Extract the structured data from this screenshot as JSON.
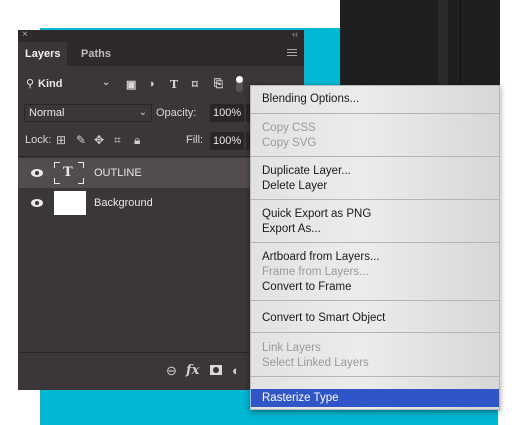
{
  "panel": {
    "tabs": [
      {
        "label": "Layers",
        "active": true
      },
      {
        "label": "Paths",
        "active": false
      }
    ],
    "close_glyph": "×",
    "collapse_glyph": "‹‹",
    "filter": {
      "kind_label": "Kind"
    },
    "blend_mode": "Normal",
    "opacity_label": "Opacity:",
    "opacity_value": "100%",
    "lock_label": "Lock:",
    "fill_label": "Fill:",
    "fill_value": "100%",
    "layers": [
      {
        "name": "OUTLINE",
        "type": "text",
        "thumb_glyph": "T",
        "selected": true,
        "visible": true
      },
      {
        "name": "Background",
        "type": "image",
        "selected": false,
        "visible": true
      }
    ],
    "icons": [
      "search-icon",
      "pixel-filter-icon",
      "adjustment-filter-icon",
      "type-filter-icon",
      "shape-filter-icon",
      "smart-object-filter-icon",
      "filter-toggle",
      "lock-transparent-icon",
      "lock-brush-icon",
      "lock-move-icon",
      "lock-artboard-icon",
      "lock-all-icon",
      "eye-icon",
      "link-icon",
      "fx-icon",
      "mask-icon",
      "adjustment-icon",
      "folder-icon",
      "new-layer-icon"
    ]
  },
  "context_menu": {
    "groups": [
      [
        {
          "label": "Blending Options...",
          "enabled": true
        }
      ],
      [
        {
          "label": "Copy CSS",
          "enabled": false
        },
        {
          "label": "Copy SVG",
          "enabled": false
        }
      ],
      [
        {
          "label": "Duplicate Layer...",
          "enabled": true
        },
        {
          "label": "Delete Layer",
          "enabled": true
        }
      ],
      [
        {
          "label": "Quick Export as PNG",
          "enabled": true
        },
        {
          "label": "Export As...",
          "enabled": true
        }
      ],
      [
        {
          "label": "Artboard from Layers...",
          "enabled": true
        },
        {
          "label": "Frame from Layers...",
          "enabled": false
        },
        {
          "label": "Convert to Frame",
          "enabled": true
        }
      ],
      [
        {
          "label": "Convert to Smart Object",
          "enabled": true
        }
      ],
      [
        {
          "label": "Link Layers",
          "enabled": false
        },
        {
          "label": "Select Linked Layers",
          "enabled": false
        }
      ],
      [
        {
          "label": "Rasterize Type",
          "enabled": true,
          "highlighted": true
        }
      ]
    ]
  },
  "colors": {
    "panel_bg": "#3b3637",
    "selected_row": "#524c4d",
    "accent_backdrop": "#00b7d4",
    "menu_highlight": "#2f55c7"
  }
}
